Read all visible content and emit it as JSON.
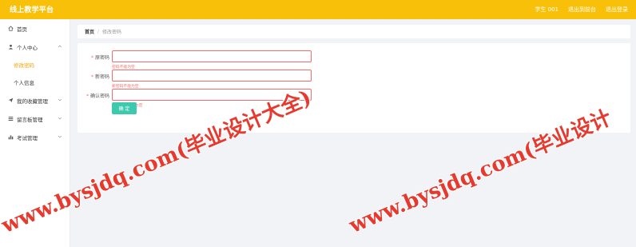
{
  "header": {
    "app_title": "线上教学平台",
    "user_label": "学生 001",
    "exit_to_front": "退出到前台",
    "logout": "退出登录"
  },
  "sidebar": {
    "items": [
      {
        "label": "首页",
        "icon": "home-icon"
      },
      {
        "label": "个人中心",
        "icon": "user-icon"
      },
      {
        "label": "我的收藏管理",
        "icon": "send-icon"
      },
      {
        "label": "留言板管理",
        "icon": "list-icon"
      },
      {
        "label": "考试管理",
        "icon": "chart-icon"
      }
    ],
    "subitems": [
      {
        "label": "修改密码",
        "active": true
      },
      {
        "label": "个人信息",
        "active": false
      }
    ]
  },
  "breadcrumb": {
    "home": "首页",
    "separator": "/",
    "current": "修改密码"
  },
  "form": {
    "fields": [
      {
        "label": "原密码",
        "value": "",
        "error": "密码不能为空"
      },
      {
        "label": "新密码",
        "value": "",
        "error": "新密码不能为空"
      },
      {
        "label": "确认密码",
        "value": "",
        "error": "确认密码不能为空"
      }
    ],
    "submit_label": "确 定"
  },
  "watermark": {
    "text": "www.bysjdq.com(毕业设计大全)",
    "text_2": "www.bysjdq.com(毕业设计"
  },
  "colors": {
    "header_bg": "#f9c00a",
    "accent": "#f5a300",
    "error": "#f56c6c",
    "button": "#3dc9ad",
    "watermark": "#e63a2e"
  }
}
